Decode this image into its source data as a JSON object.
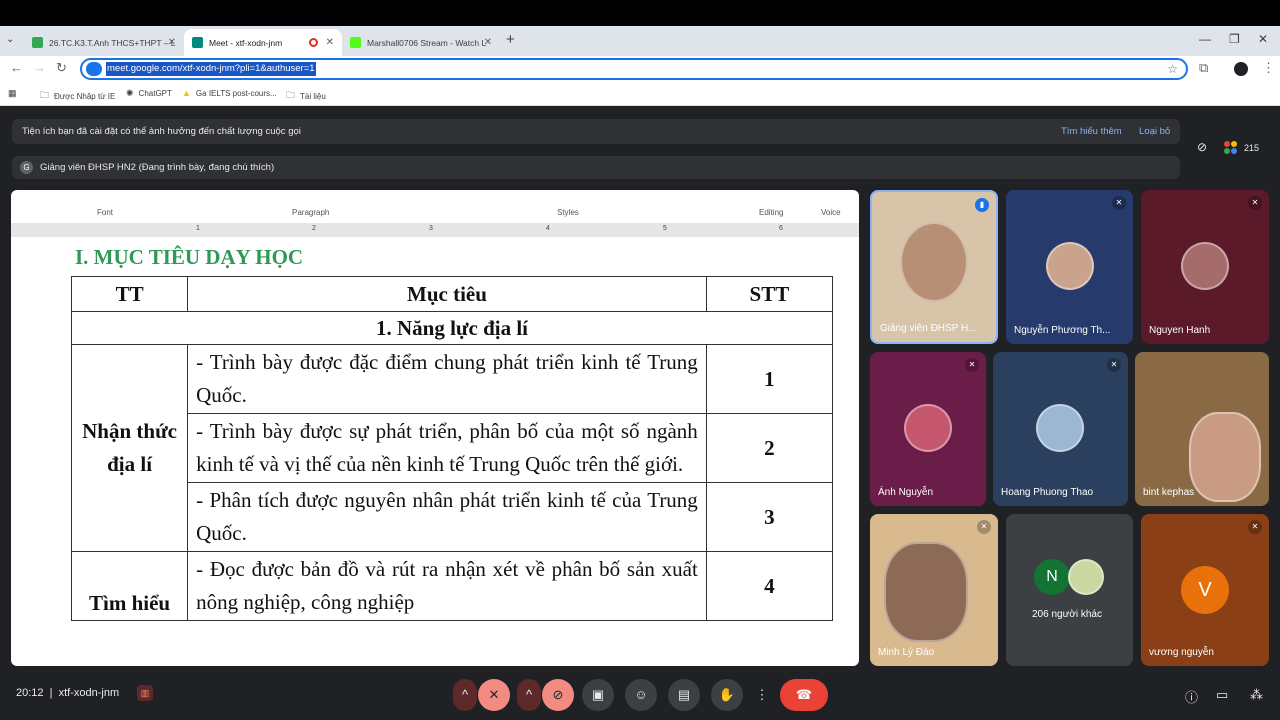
{
  "browser": {
    "tabs": [
      {
        "label": "26.TC.K3.T.Anh THCS+THPT – L",
        "color": "#34a853"
      },
      {
        "label": "Meet - xtf-xodn-jnm",
        "color": "#00897b"
      },
      {
        "label": "Marshall0706 Stream - Watch L",
        "color": "#53fc18"
      }
    ],
    "url": "meet.google.com/xtf-xodn-jnm?pli=1&authuser=1",
    "bookmarks": [
      "Được Nhập từ IE",
      "ChatGPT",
      "Ga IELTS post-cours...",
      "Tài liệu"
    ]
  },
  "meet": {
    "banner_text": "Tiện ích bạn đã cài đặt có thể ảnh hưởng đến chất lượng cuộc gọi",
    "banner_learn": "Tìm hiểu thêm",
    "banner_remove": "Loại bỏ",
    "presenter_initial": "G",
    "presenter_text": "Giảng viên ĐHSP HN2 (Đang trình bày, đang chú thích)",
    "participant_count": "215",
    "meeting_code": "xtf-xodn-jnm",
    "time": "20:12"
  },
  "slide": {
    "ribbon": [
      "Font",
      "Paragraph",
      "Styles",
      "Editing",
      "Voice"
    ],
    "ruler": [
      "1",
      "2",
      "3",
      "4",
      "5",
      "6"
    ],
    "title": "I. MỤC TIÊU DẠY HỌC",
    "headers": [
      "TT",
      "Mục tiêu",
      "STT"
    ],
    "section": "1. Năng lực địa lí",
    "group1": "Nhận thức địa lí",
    "group2": "Tìm hiểu",
    "rows": [
      {
        "goal": "- Trình bày được đặc điểm chung phát triển kinh tế Trung Quốc.",
        "num": "1"
      },
      {
        "goal": "- Trình bày được sự phát triển, phân bố của một số ngành kinh tế và vị thế của nền kinh tế Trung Quốc trên thế giới.",
        "num": "2"
      },
      {
        "goal": "- Phân tích được nguyên nhân phát triển kinh tế của Trung Quốc.",
        "num": "3"
      },
      {
        "goal": "- Đọc được bản đồ và rút ra nhận xét về phân bố sản xuất nông nghiệp, công nghiệp",
        "num": "4"
      }
    ]
  },
  "participants": [
    {
      "name": "Giảng viên ĐHSP H...",
      "bg": "#d8c4a8"
    },
    {
      "name": "Nguyễn Phương Th...",
      "bg": "#263b6b"
    },
    {
      "name": "Nguyen Hanh",
      "bg": "#5a1a2a"
    },
    {
      "name": "Ánh Nguyễn",
      "bg": "#6b1d4a"
    },
    {
      "name": "Hoang Phuong Thao",
      "bg": "#2b3f5e"
    },
    {
      "name": "bint kephas",
      "bg": "#8a6a45"
    },
    {
      "name": "Minh Lý Đào",
      "bg": "#d9b98e"
    },
    {
      "name": "206 người khác",
      "bg": "#3c4043"
    },
    {
      "name": "vương nguyễn",
      "bg": "#8b3f16"
    }
  ],
  "others_initial": "N",
  "vuong_initial": "V"
}
